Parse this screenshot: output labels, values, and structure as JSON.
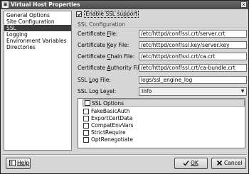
{
  "window": {
    "title": "Virtual Host Properties"
  },
  "sidebar": {
    "items": [
      {
        "label": "General Options",
        "selected": false
      },
      {
        "label": "Site Configuration",
        "selected": false
      },
      {
        "label": "SSL",
        "selected": true
      },
      {
        "label": "Logging",
        "selected": false
      },
      {
        "label": "Environment Variables",
        "selected": false
      },
      {
        "label": "Directories",
        "selected": false
      }
    ]
  },
  "ssl": {
    "enable_label": "Enable SSL support",
    "enable_checked": true,
    "group_title": "SSL Configuration",
    "cert_file": {
      "label_pre": "Certificate ",
      "label_key": "F",
      "label_post": "ile:",
      "value": "/etc/httpd/conf/ssl.crt/server.crt"
    },
    "cert_key_file": {
      "label_pre": "Certificate ",
      "label_key": "K",
      "label_post": "ey File:",
      "value": "/etc/httpd/conf/ssl.key/server.key"
    },
    "cert_chain_file": {
      "label_pre": "Certificate ",
      "label_key": "C",
      "label_post": "hain File:",
      "value": "/etc/httpd/conf/ssl.crt/ca.crt"
    },
    "cert_authority_file": {
      "label_pre": "Certificate ",
      "label_key": "A",
      "label_post": "uthority File:",
      "value": "/etc/httpd/conf/ssl.crt/ca-bundle.crt"
    },
    "log_file": {
      "label_pre": "SSL ",
      "label_key": "L",
      "label_post": "og File:",
      "value": "logs/ssl_engine_log"
    },
    "log_level": {
      "label_pre": "SSL Log Le",
      "label_key": "v",
      "label_post": "el:",
      "value": "Info"
    },
    "options": {
      "header": "SSL Options",
      "items": [
        {
          "label": "FakeBasicAuth",
          "checked": false
        },
        {
          "label": "ExportCertData",
          "checked": false
        },
        {
          "label": "CompatEnvVars",
          "checked": false
        },
        {
          "label": "StrictRequire",
          "checked": false
        },
        {
          "label": "OptRenegotiate",
          "checked": false
        }
      ]
    }
  },
  "buttons": {
    "help_label": "Help",
    "ok_label": "OK",
    "cancel_label": "Cancel"
  },
  "icons": {
    "window": "window-icon",
    "close": "close-icon",
    "help": "help-icon",
    "ok": "ok-icon",
    "cancel": "cancel-icon"
  }
}
